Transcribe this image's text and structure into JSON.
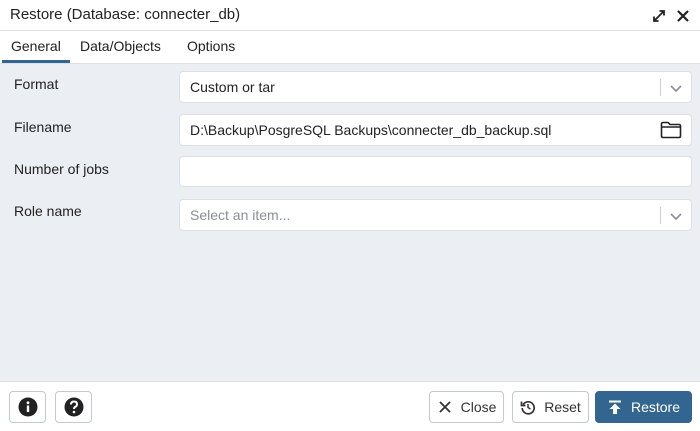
{
  "dialog": {
    "title": "Restore (Database: connecter_db)"
  },
  "tabs": [
    {
      "label": "General",
      "active": true
    },
    {
      "label": "Data/Objects",
      "active": false
    },
    {
      "label": "Options",
      "active": false
    }
  ],
  "form": {
    "format": {
      "label": "Format",
      "value": "Custom or tar"
    },
    "filename": {
      "label": "Filename",
      "value": "D:\\Backup\\PosgreSQL Backups\\connecter_db_backup.sql"
    },
    "jobs": {
      "label": "Number of jobs",
      "value": ""
    },
    "role": {
      "label": "Role name",
      "placeholder": "Select an item..."
    }
  },
  "footer": {
    "close_label": "Close",
    "reset_label": "Reset",
    "restore_label": "Restore"
  },
  "icons": {
    "expand": "expand-icon",
    "close": "close-icon",
    "info": "info-icon",
    "help": "help-icon",
    "folder": "folder-icon",
    "chevron": "chevron-down-icon",
    "reset": "reset-icon",
    "restore": "upload-icon"
  },
  "colors": {
    "accent": "#326690",
    "content_bg": "#ebeef3"
  }
}
